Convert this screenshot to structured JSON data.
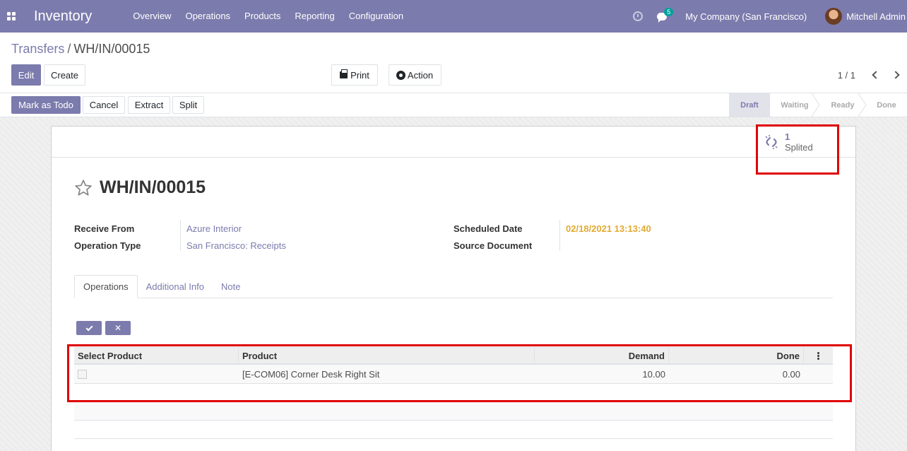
{
  "navbar": {
    "app_title": "Inventory",
    "menu": [
      "Overview",
      "Operations",
      "Products",
      "Reporting",
      "Configuration"
    ],
    "chat_badge": "5",
    "company": "My Company (San Francisco)",
    "user": "Mitchell Admin"
  },
  "breadcrumb": {
    "parent": "Transfers",
    "separator": "/",
    "current": "WH/IN/00015"
  },
  "control": {
    "edit_label": "Edit",
    "create_label": "Create",
    "print_label": "Print",
    "action_label": "Action",
    "pager": "1 / 1"
  },
  "statusbar": {
    "buttons": [
      "Mark as Todo",
      "Cancel",
      "Extract",
      "Split"
    ],
    "stages": [
      "Draft",
      "Waiting",
      "Ready",
      "Done"
    ],
    "active_stage": "Draft"
  },
  "smart_button": {
    "value": "1",
    "label": "Splited"
  },
  "record": {
    "title": "WH/IN/00015",
    "receive_from_label": "Receive From",
    "receive_from": "Azure Interior",
    "operation_type_label": "Operation Type",
    "operation_type": "San Francisco: Receipts",
    "scheduled_date_label": "Scheduled Date",
    "scheduled_date": "02/18/2021 13:13:40",
    "source_document_label": "Source Document",
    "source_document": ""
  },
  "tabs": [
    "Operations",
    "Additional Info",
    "Note"
  ],
  "table": {
    "columns": [
      "Select Product",
      "Product",
      "Demand",
      "Done"
    ],
    "rows": [
      {
        "product": "[E-COM06] Corner Desk Right Sit",
        "demand": "10.00",
        "done": "0.00"
      }
    ]
  },
  "colors": {
    "brand": "#7c7bad",
    "date": "#e2aa31",
    "highlight": "#e00000"
  }
}
